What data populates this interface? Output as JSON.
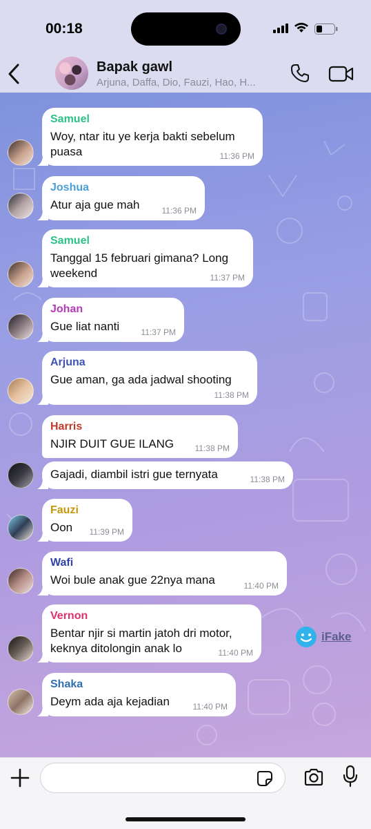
{
  "status_bar": {
    "time": "00:18"
  },
  "header": {
    "title": "Bapak gawl",
    "members": "Arjuna, Daffa, Dio, Fauzi, Hao, H..."
  },
  "messages": [
    {
      "sender": "Samuel",
      "color": "#2bc28a",
      "lines": [
        "Woy, ntar itu ye kerja bakti sebelum",
        "puasa"
      ],
      "time": "11:36 PM"
    },
    {
      "sender": "Joshua",
      "color": "#4aa0d6",
      "lines": [
        "Atur aja gue mah"
      ],
      "time": "11:36 PM"
    },
    {
      "sender": "Samuel",
      "color": "#2bc28a",
      "lines": [
        "Tanggal 15 februari gimana? Long",
        "weekend"
      ],
      "time": "11:37 PM"
    },
    {
      "sender": "Johan",
      "color": "#b53ab8",
      "lines": [
        "Gue liat nanti"
      ],
      "time": "11:37 PM"
    },
    {
      "sender": "Arjuna",
      "color": "#3f51b5",
      "lines": [
        "Gue aman, ga ada jadwal shooting"
      ],
      "time": "11:38 PM"
    },
    {
      "sender": "Harris",
      "color": "#c0392b",
      "lines": [
        "NJIR DUIT GUE ILANG"
      ],
      "time": "11:38 PM"
    },
    {
      "sender": "",
      "color": "#c0392b",
      "lines": [
        "Gajadi, diambil istri gue ternyata"
      ],
      "time": "11:38 PM"
    },
    {
      "sender": "Fauzi",
      "color": "#c8960c",
      "lines": [
        "Oon"
      ],
      "time": "11:39 PM"
    },
    {
      "sender": "Wafi",
      "color": "#3042a8",
      "lines": [
        "Woi bule anak gue 22nya mana"
      ],
      "time": "11:40 PM"
    },
    {
      "sender": "Vernon",
      "color": "#e0306e",
      "lines": [
        "Bentar njir si martin jatoh dri motor,",
        "keknya ditolongin anak lo"
      ],
      "time": "11:40 PM"
    },
    {
      "sender": "Shaka",
      "color": "#2f6fb0",
      "lines": [
        "Deym ada aja kejadian"
      ],
      "time": "11:40 PM"
    }
  ],
  "watermark": {
    "label": "iFake"
  },
  "input": {
    "placeholder": ""
  },
  "icons": {
    "back": "chevron-left-icon",
    "call": "phone-icon",
    "video": "video-camera-icon",
    "attach": "plus-icon",
    "sticker": "sticker-icon",
    "camera": "camera-icon",
    "mic": "microphone-icon"
  }
}
